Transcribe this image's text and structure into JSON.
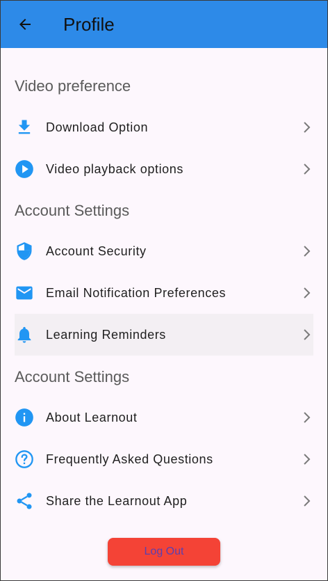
{
  "appbar": {
    "title": "Profile"
  },
  "sections": [
    {
      "header": "Video preference",
      "items": [
        {
          "label": "Download Option",
          "icon": "download-icon"
        },
        {
          "label": "Video playback options",
          "icon": "play-circle-icon"
        }
      ]
    },
    {
      "header": "Account Settings",
      "items": [
        {
          "label": "Account Security",
          "icon": "shield-icon"
        },
        {
          "label": "Email Notification Preferences",
          "icon": "email-icon"
        },
        {
          "label": "Learning Reminders",
          "icon": "bell-icon"
        }
      ]
    },
    {
      "header": "Account Settings",
      "items": [
        {
          "label": "About Learnout",
          "icon": "info-icon"
        },
        {
          "label": "Frequently Asked Questions",
          "icon": "help-circle-icon"
        },
        {
          "label": "Share the Learnout App",
          "icon": "share-icon"
        }
      ]
    }
  ],
  "logout_label": "Log Out",
  "colors": {
    "appbar": "#2d8ae8",
    "icon": "#2196f3",
    "logout": "#f44336",
    "logout_text": "#5b3fb0",
    "background": "#fdf7fd"
  }
}
